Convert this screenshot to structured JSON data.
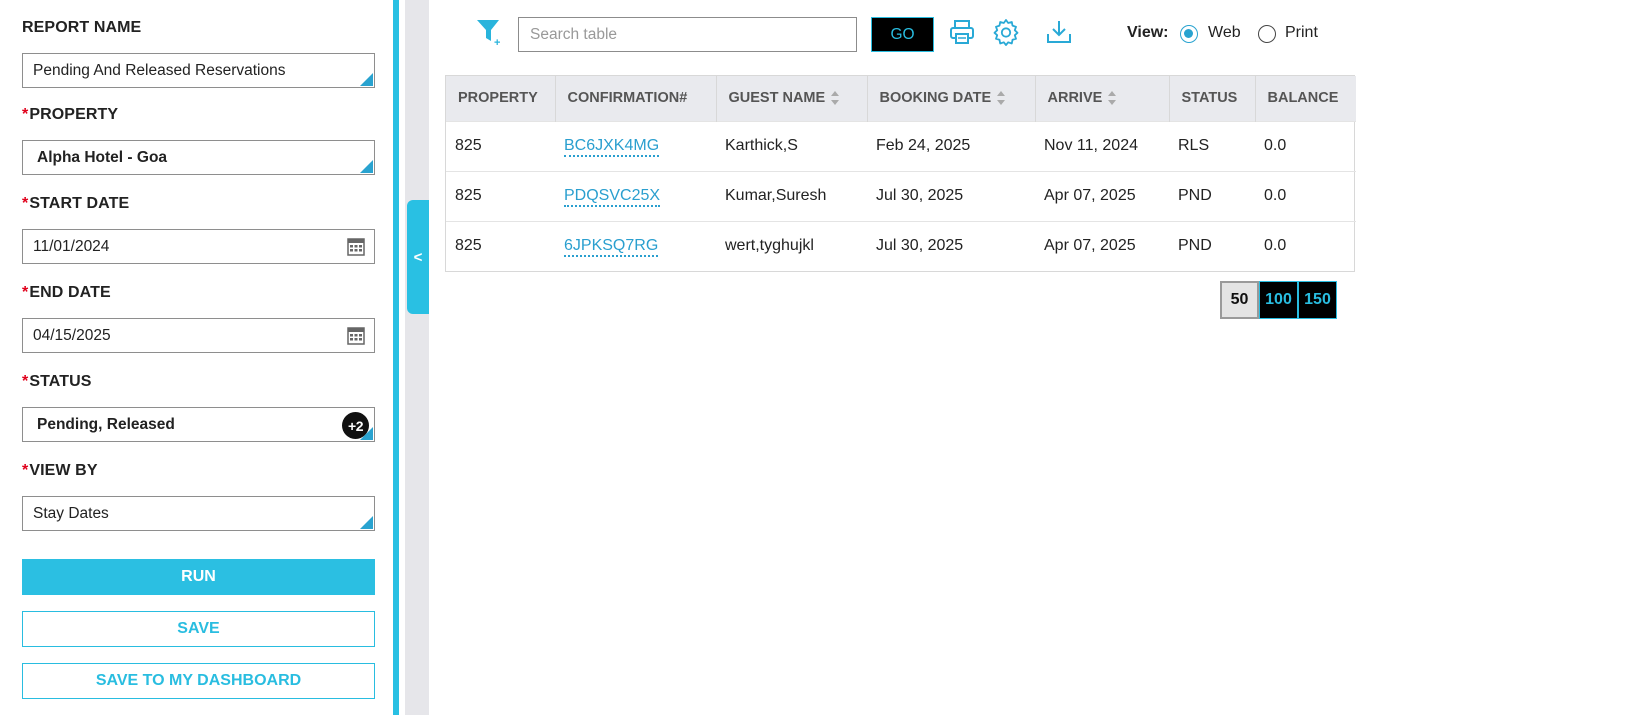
{
  "left_panel": {
    "report_name": {
      "label": "REPORT NAME",
      "value": "Pending And Released Reservations"
    },
    "property": {
      "label": "PROPERTY",
      "required": "*",
      "value": "Alpha Hotel - Goa"
    },
    "start_date": {
      "label": "START DATE",
      "required": "*",
      "value": "11/01/2024"
    },
    "end_date": {
      "label": "END DATE",
      "required": "*",
      "value": "04/15/2025"
    },
    "status": {
      "label": "STATUS",
      "required": "*",
      "value": "Pending, Released",
      "extra_count": "+2"
    },
    "view_by": {
      "label": "VIEW BY",
      "required": "*",
      "value": "Stay Dates"
    },
    "run_label": "RUN",
    "save_label": "SAVE",
    "save_dashboard_label": "SAVE TO MY DASHBOARD",
    "collapse_glyph": "<"
  },
  "toolbar": {
    "search_placeholder": "Search table",
    "go_label": "GO",
    "icons": [
      "filter-icon",
      "print-icon",
      "gear-icon",
      "download-icon"
    ],
    "view_label": "View:",
    "view_options": [
      {
        "label": "Web",
        "selected": true
      },
      {
        "label": "Print",
        "selected": false
      }
    ]
  },
  "table": {
    "columns": [
      {
        "label": "PROPERTY",
        "sortable": false
      },
      {
        "label": "CONFIRMATION#",
        "sortable": false
      },
      {
        "label": "GUEST NAME",
        "sortable": true
      },
      {
        "label": "BOOKING DATE",
        "sortable": true
      },
      {
        "label": "ARRIVE",
        "sortable": true
      },
      {
        "label": "STATUS",
        "sortable": false
      },
      {
        "label": "BALANCE",
        "sortable": false
      }
    ],
    "rows": [
      {
        "property": "825",
        "confirmation": "BC6JXK4MG",
        "guest": "Karthick,S",
        "booking_date": "Feb 24, 2025",
        "arrive": "Nov 11, 2024",
        "status": "RLS",
        "balance": "0.0"
      },
      {
        "property": "825",
        "confirmation": "PDQSVC25X",
        "guest": "Kumar,Suresh",
        "booking_date": "Jul 30, 2025",
        "arrive": "Apr 07, 2025",
        "status": "PND",
        "balance": "0.0"
      },
      {
        "property": "825",
        "confirmation": "6JPKSQ7RG",
        "guest": "wert,tyghujkl",
        "booking_date": "Jul 30, 2025",
        "arrive": "Apr 07, 2025",
        "status": "PND",
        "balance": "0.0"
      }
    ]
  },
  "pagination": {
    "sizes": [
      "50",
      "100",
      "150"
    ],
    "active": "50"
  },
  "colors": {
    "accent": "#29bfe3",
    "link": "#2a9fcf",
    "required": "#e0001b",
    "header_bg": "#e9eaee"
  }
}
